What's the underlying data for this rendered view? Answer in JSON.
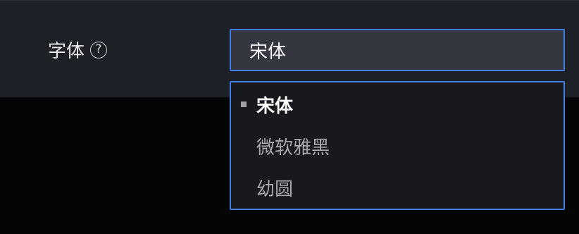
{
  "field": {
    "label": "字体",
    "help_icon": "question-circle-icon",
    "help_glyph": "?"
  },
  "select": {
    "value": "宋体"
  },
  "dropdown": {
    "options": [
      {
        "label": "宋体",
        "selected": true,
        "marker": "square-bullet-icon"
      },
      {
        "label": "微软雅黑",
        "selected": false
      },
      {
        "label": "幼圆",
        "selected": false
      }
    ]
  },
  "colors": {
    "accent_border": "#3f7fe6",
    "panel_bg": "#1d2026",
    "page_bg": "#050506"
  }
}
